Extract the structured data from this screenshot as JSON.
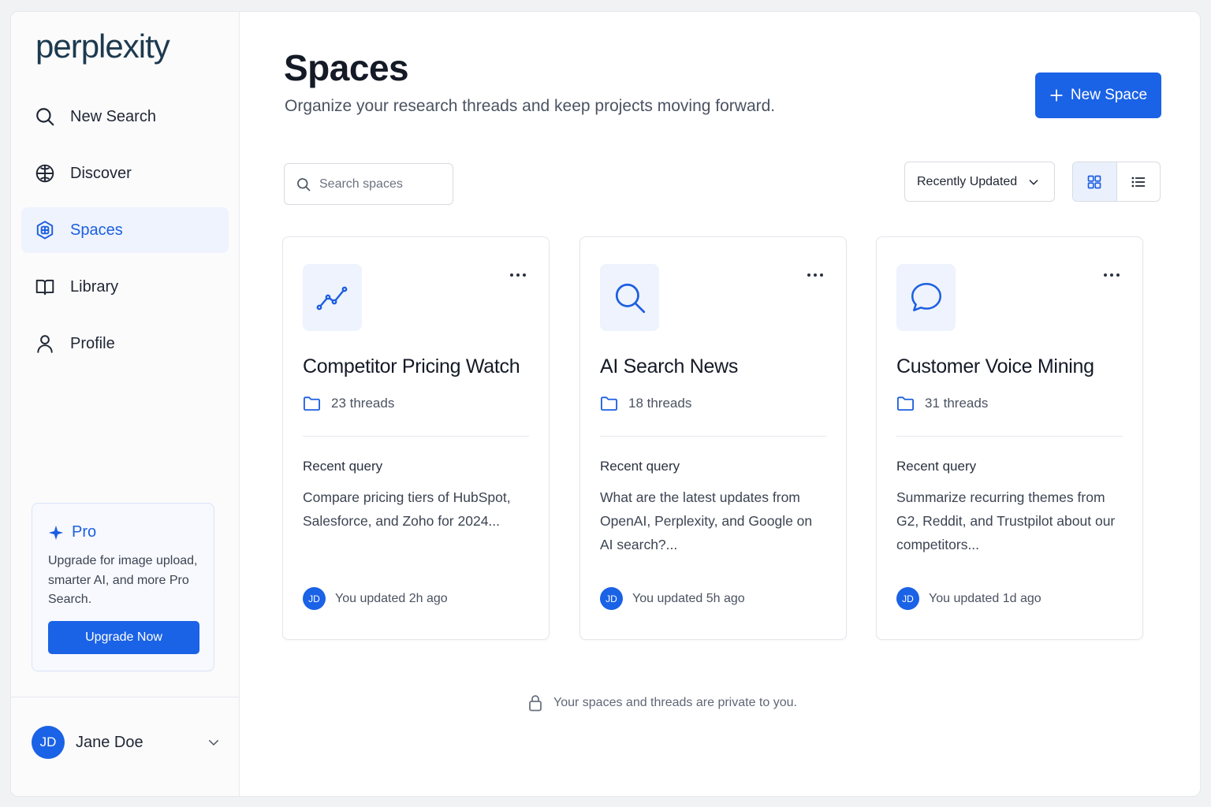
{
  "brand": {
    "logo": "perplexity",
    "accent": "#1a62e6"
  },
  "sidebar": {
    "items": [
      {
        "label": "New Search",
        "icon": "search-icon",
        "active": false
      },
      {
        "label": "Discover",
        "icon": "globe-icon",
        "active": false
      },
      {
        "label": "Spaces",
        "icon": "spaces-icon",
        "active": true
      },
      {
        "label": "Library",
        "icon": "book-icon",
        "active": false
      },
      {
        "label": "Profile",
        "icon": "user-icon",
        "active": false
      }
    ],
    "pro": {
      "title": "Pro",
      "description": "Upgrade for image upload, smarter AI, and more Pro Search.",
      "button": "Upgrade Now"
    },
    "user": {
      "initials": "JD",
      "name": "Jane Doe"
    }
  },
  "header": {
    "title": "Spaces",
    "subtitle": "Organize your research threads and keep projects moving forward.",
    "new_button": "New Space"
  },
  "toolbar": {
    "search_placeholder": "Search spaces",
    "sort_value": "Recently Updated",
    "view_mode": "grid"
  },
  "cards": [
    {
      "icon": "trend-line-icon",
      "title": "Competitor Pricing Watch",
      "threads": "23 threads",
      "recent_label": "Recent query",
      "query": "Compare pricing tiers of HubSpot, Salesforce, and Zoho for 2024...",
      "initials": "JD",
      "updated": "You updated 2h ago"
    },
    {
      "icon": "search-icon",
      "title": "AI Search News",
      "threads": "18 threads",
      "recent_label": "Recent query",
      "query": "What are the latest updates from OpenAI, Perplexity, and Google on AI search?...",
      "initials": "JD",
      "updated": "You updated 5h ago"
    },
    {
      "icon": "chat-bubble-icon",
      "title": "Customer Voice Mining",
      "threads": "31 threads",
      "recent_label": "Recent query",
      "query": "Summarize recurring themes from G2, Reddit, and Trustpilot about our competitors...",
      "initials": "JD",
      "updated": "You updated 1d ago"
    }
  ],
  "footer": {
    "privacy": "Your spaces and threads are private to you."
  }
}
